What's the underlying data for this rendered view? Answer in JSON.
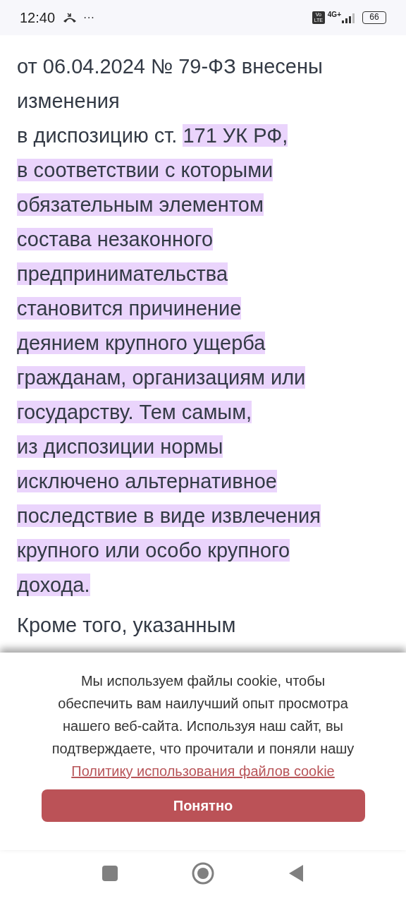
{
  "status_bar": {
    "time": "12:40",
    "more": "···",
    "volte": "Vo LTE",
    "network": "4G+",
    "battery": "66"
  },
  "article": {
    "paragraphs": [
      {
        "lines": [
          [
            {
              "text": "от 06.04.2024 № 79-ФЗ внесены",
              "highlighted": false
            }
          ],
          [
            {
              "text": "изменения",
              "highlighted": false
            }
          ],
          [
            {
              "text": "в диспозицию ст. ",
              "highlighted": false
            },
            {
              "text": "171 УК РФ,",
              "highlighted": true
            }
          ],
          [
            {
              "text": "в соответствии с которыми",
              "highlighted": true
            }
          ],
          [
            {
              "text": "обязательным элементом",
              "highlighted": true
            }
          ],
          [
            {
              "text": "состава незаконного",
              "highlighted": true
            }
          ],
          [
            {
              "text": "предпринимательства",
              "highlighted": true
            }
          ],
          [
            {
              "text": "становится причинение",
              "highlighted": true
            }
          ],
          [
            {
              "text": "деянием крупного ущерба",
              "highlighted": true
            }
          ],
          [
            {
              "text": "гражданам, организациям или",
              "highlighted": true
            }
          ],
          [
            {
              "text": "государству. Тем самым,",
              "highlighted": true
            }
          ],
          [
            {
              "text": "из диспозиции нормы",
              "highlighted": true
            }
          ],
          [
            {
              "text": "исключено альтернативное",
              "highlighted": true
            }
          ],
          [
            {
              "text": "последствие в виде извлечения",
              "highlighted": true
            }
          ],
          [
            {
              "text": "крупного или особо крупного",
              "highlighted": true
            }
          ],
          [
            {
              "text": "дохода.",
              "highlighted": true
            }
          ]
        ]
      },
      {
        "lines": [
          [
            {
              "text": "Кроме того, указанным",
              "highlighted": false
            }
          ]
        ]
      }
    ]
  },
  "cookie_banner": {
    "text": "Мы используем файлы cookie, чтобы обеспечить вам наилучший опыт просмотра нашего веб-сайта. Используя наш сайт, вы подтверждаете, что прочитали и поняли нашу",
    "link": "Политику использования файлов cookie",
    "button": "Понятно"
  }
}
